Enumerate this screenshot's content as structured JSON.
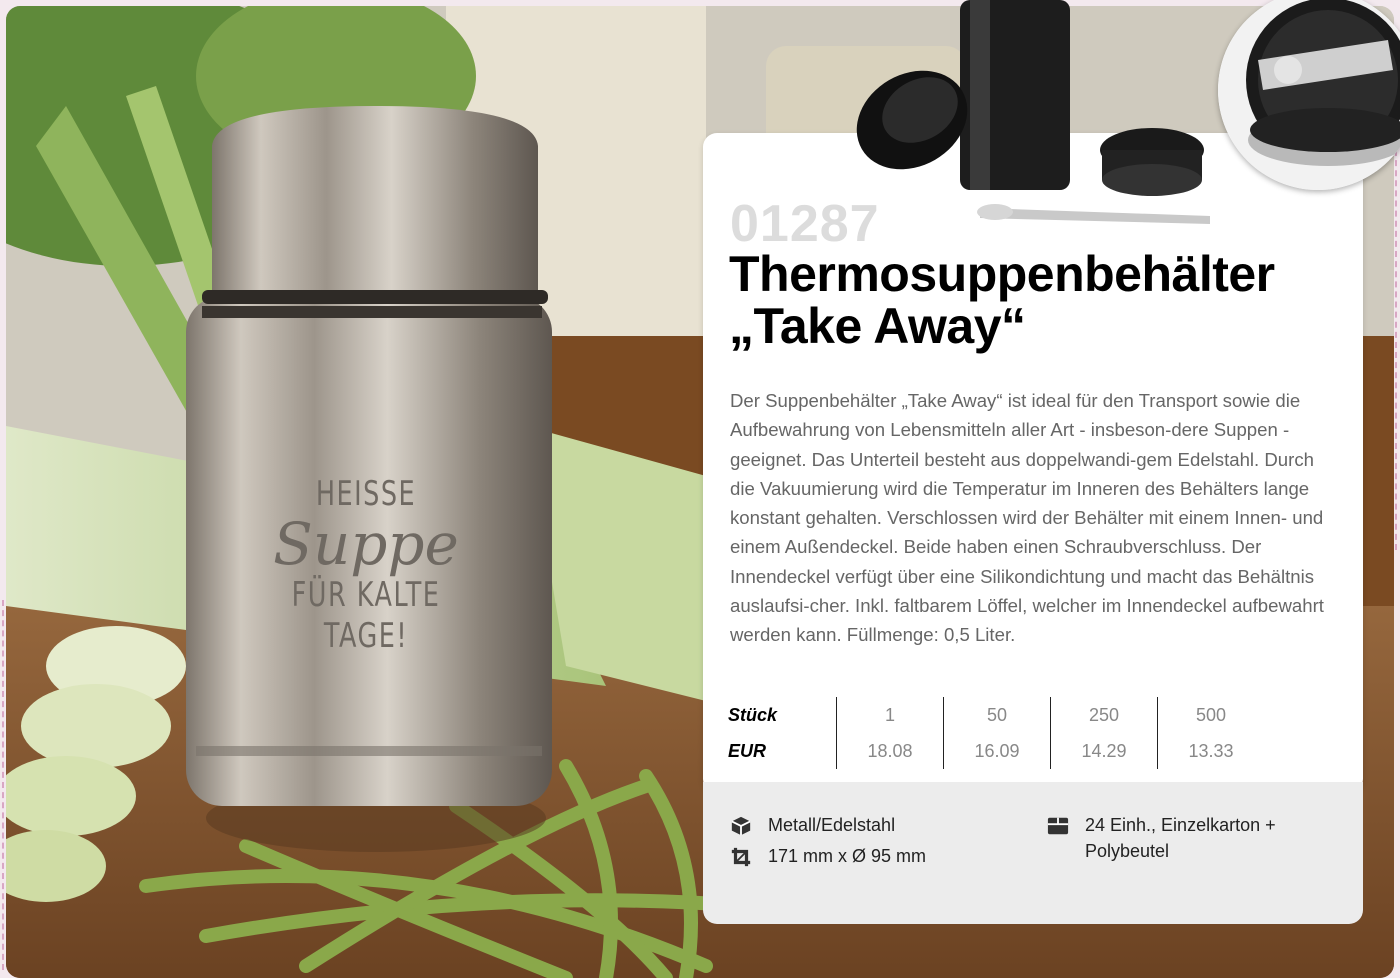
{
  "product": {
    "article_number": "01287",
    "title_line1": "Thermosuppenbehälter",
    "title_line2": "„Take Away“",
    "description": "Der Suppenbehälter „Take Away“ ist ideal für den Transport sowie die Aufbewahrung von Lebensmitteln aller Art - insbeson-dere Suppen - geeignet. Das Unterteil besteht aus doppelwandi-gem Edelstahl. Durch die Vakuumierung wird die Temperatur im Inneren des Behälters lange konstant gehalten. Verschlossen wird der Behälter mit einem Innen- und einem Außendeckel. Beide haben einen Schraubverschluss. Der Innendeckel verfügt über eine Silikondichtung und macht das Behältnis auslaufsi-cher. Inkl. faltbarem Löffel, welcher im Innendeckel aufbewahrt werden kann. Füllmenge: 0,5 Liter."
  },
  "prices": {
    "qty_label": "Stück",
    "eur_label": "EUR",
    "quantities": [
      "1",
      "50",
      "250",
      "500"
    ],
    "eur": [
      "18.08",
      "16.09",
      "14.29",
      "13.33"
    ]
  },
  "specs": {
    "material": "Metall/Edelstahl",
    "dimensions": "171 mm x Ø 95 mm",
    "packaging_line1": "24 Einh., Einzelkarton +",
    "packaging_line2": "Polybeutel"
  },
  "engraving": {
    "line1": "HEISSE",
    "line2": "Suppe",
    "line3": "FÜR KALTE",
    "line4": "TAGE!"
  },
  "icons": {
    "material": "box-icon",
    "dimensions": "crop-icon",
    "packaging": "package-icon"
  },
  "colors": {
    "title": "#000000",
    "article_number": "#dcdcdc",
    "body_text": "#666666",
    "footer_bg": "#ececec"
  }
}
